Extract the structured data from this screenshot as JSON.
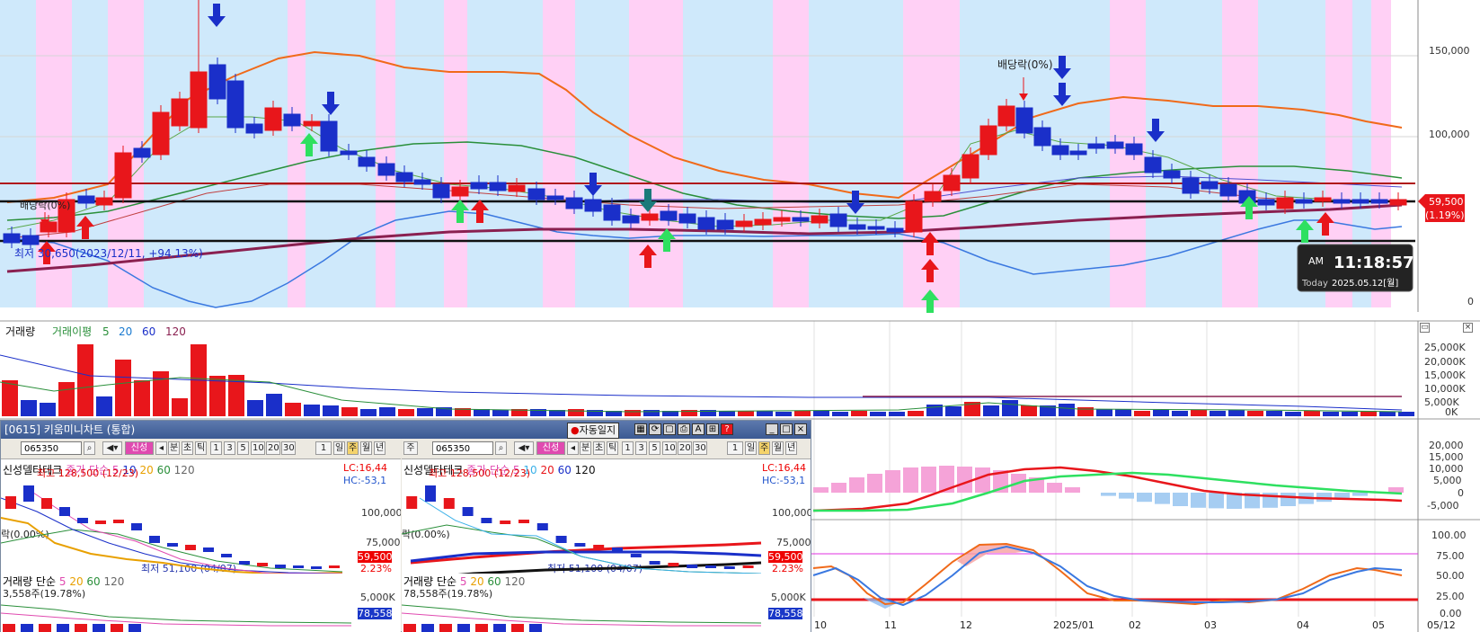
{
  "main": {
    "price_axis": [
      "150,000",
      "100,000",
      "0"
    ],
    "current_price": "59,500",
    "current_change": "(1.19%)",
    "dividend_labels": [
      "배당락(0%)",
      "배당락(0%)"
    ],
    "low_annotation": "최저 30,650(2023/12/11, +94.13%)",
    "clock": {
      "ampm": "AM",
      "time": "11:18:57",
      "date_label": "Today",
      "date": "2025.05.12[월]"
    }
  },
  "volume_pane": {
    "legend": {
      "title": "거래량",
      "ma_label": "거래이평",
      "periods": [
        "5",
        "20",
        "60",
        "120"
      ]
    },
    "axis": [
      "25,000K",
      "20,000K",
      "15,000K",
      "10,000K",
      "5,000K",
      "0K"
    ]
  },
  "macd_pane": {
    "axis": [
      "20,000",
      "15,000",
      "10,000",
      "5,000",
      "0",
      "-5,000"
    ]
  },
  "stoch_pane": {
    "axis": [
      "100.00",
      "75.00",
      "50.00",
      "25.00",
      "0.00"
    ]
  },
  "x_axis": [
    "10",
    "11",
    "12",
    "2025/01",
    "02",
    "03",
    "04",
    "05",
    "05/12"
  ],
  "mini_window": {
    "title": "[0615] 키움미니차트 (통합)",
    "auto_log": "자동일지",
    "left": {
      "period": "",
      "code": "065350",
      "search_btn": "🔍",
      "ind_btn": "신성",
      "bun": "분",
      "cho": "초",
      "tick": "틱",
      "nums": [
        "1",
        "3",
        "5",
        "10",
        "20",
        "30"
      ],
      "count": "1",
      "il": "일",
      "ju": "주",
      "wol": "월",
      "nyeon": "년",
      "legend_name": "신성델타테크",
      "legend_ma": "종가 단순 5",
      "ma": [
        "10",
        "20",
        "60",
        "120"
      ],
      "max_label": "최고 128,500 (12/23)",
      "dividend": "락(0.00%)",
      "min_label": "최저 51,100 (04/07)",
      "lc": "LC:16,44",
      "hc": "HC:-53,1",
      "axis": [
        "100,000",
        "75,000"
      ],
      "price": "59,500",
      "pct": "2.23%",
      "vol_legend": "거래량 단순",
      "vol_ma": [
        "5",
        "20",
        "60",
        "120"
      ],
      "vol_info": "3,558주(19.78%)",
      "vol_axis": "5,000K",
      "vol_box": "78,558"
    },
    "right": {
      "period": "주",
      "code": "065350",
      "search_btn": "🔍",
      "ind_btn": "신성",
      "bun": "분",
      "cho": "초",
      "tick": "틱",
      "nums": [
        "1",
        "3",
        "5",
        "10",
        "20",
        "30"
      ],
      "count": "1",
      "il": "일",
      "ju": "주",
      "wol": "월",
      "nyeon": "년",
      "legend_name": "신성델타테크",
      "legend_ma": "종가 단순 5",
      "ma": [
        "10",
        "20",
        "60",
        "120"
      ],
      "max_label": "최고 128,500 (12/23)",
      "dividend": "락(0.00%)",
      "min_label": "최저 51,100 (04/07)",
      "lc": "LC:16,44",
      "hc": "HC:-53,1",
      "axis": [
        "100,000",
        "75,000"
      ],
      "price": "59,500",
      "pct": "2.23%",
      "vol_legend": "거래량 단순",
      "vol_ma": [
        "5",
        "20",
        "60",
        "120"
      ],
      "vol_info": "78,558주(19.78%)",
      "vol_axis": "5,000K",
      "vol_box": "78,558"
    }
  },
  "colors": {
    "up": "#e8161b",
    "down": "#1a2fc9",
    "band_blue": "#cfe9fb",
    "band_pink": "#ffd0f5"
  }
}
